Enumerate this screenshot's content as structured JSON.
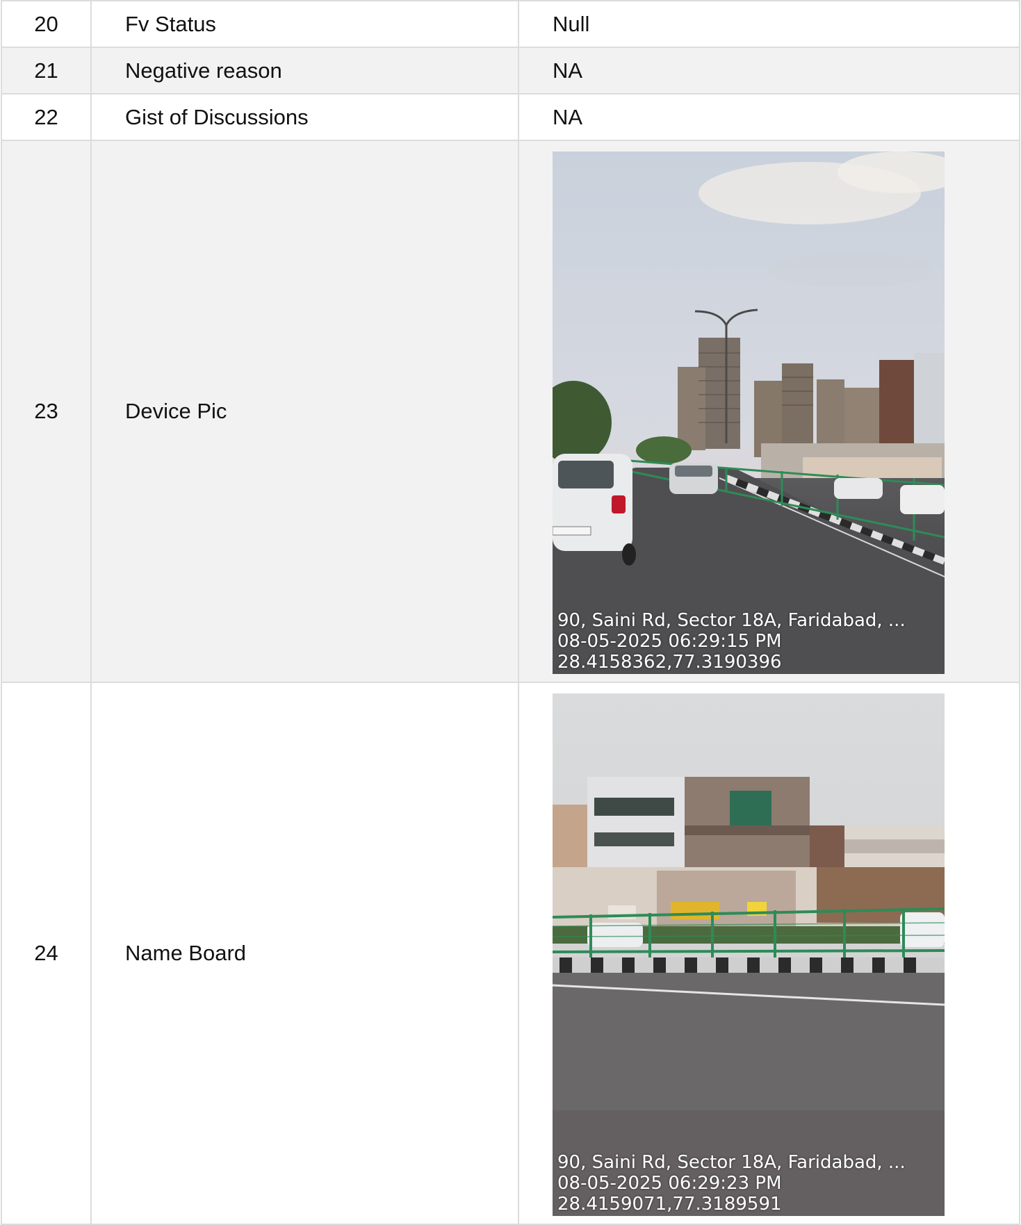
{
  "rows": [
    {
      "no": "20",
      "label": "Fv Status",
      "value": "Null"
    },
    {
      "no": "21",
      "label": "Negative reason",
      "value": "NA"
    },
    {
      "no": "22",
      "label": "Gist of Discussions",
      "value": "NA"
    },
    {
      "no": "23",
      "label": "Device Pic",
      "photo": {
        "scene": "street-with-high-rise-buildings",
        "address": "90, Saini Rd, Sector 18A, Faridabad, ...",
        "datetime": "08-05-2025 06:29:15 PM",
        "coords": "28.4158362,77.3190396"
      }
    },
    {
      "no": "24",
      "label": "Name Board",
      "photo": {
        "scene": "roadside-buildings-with-railing",
        "address": "90, Saini Rd, Sector 18A, Faridabad, ...",
        "datetime": "08-05-2025 06:29:23 PM",
        "coords": "28.4159071,77.3189591"
      }
    }
  ],
  "colors": {
    "row_alt": "#f2f2f2",
    "border": "#dcdcdc",
    "railing": "#2e8b57"
  }
}
